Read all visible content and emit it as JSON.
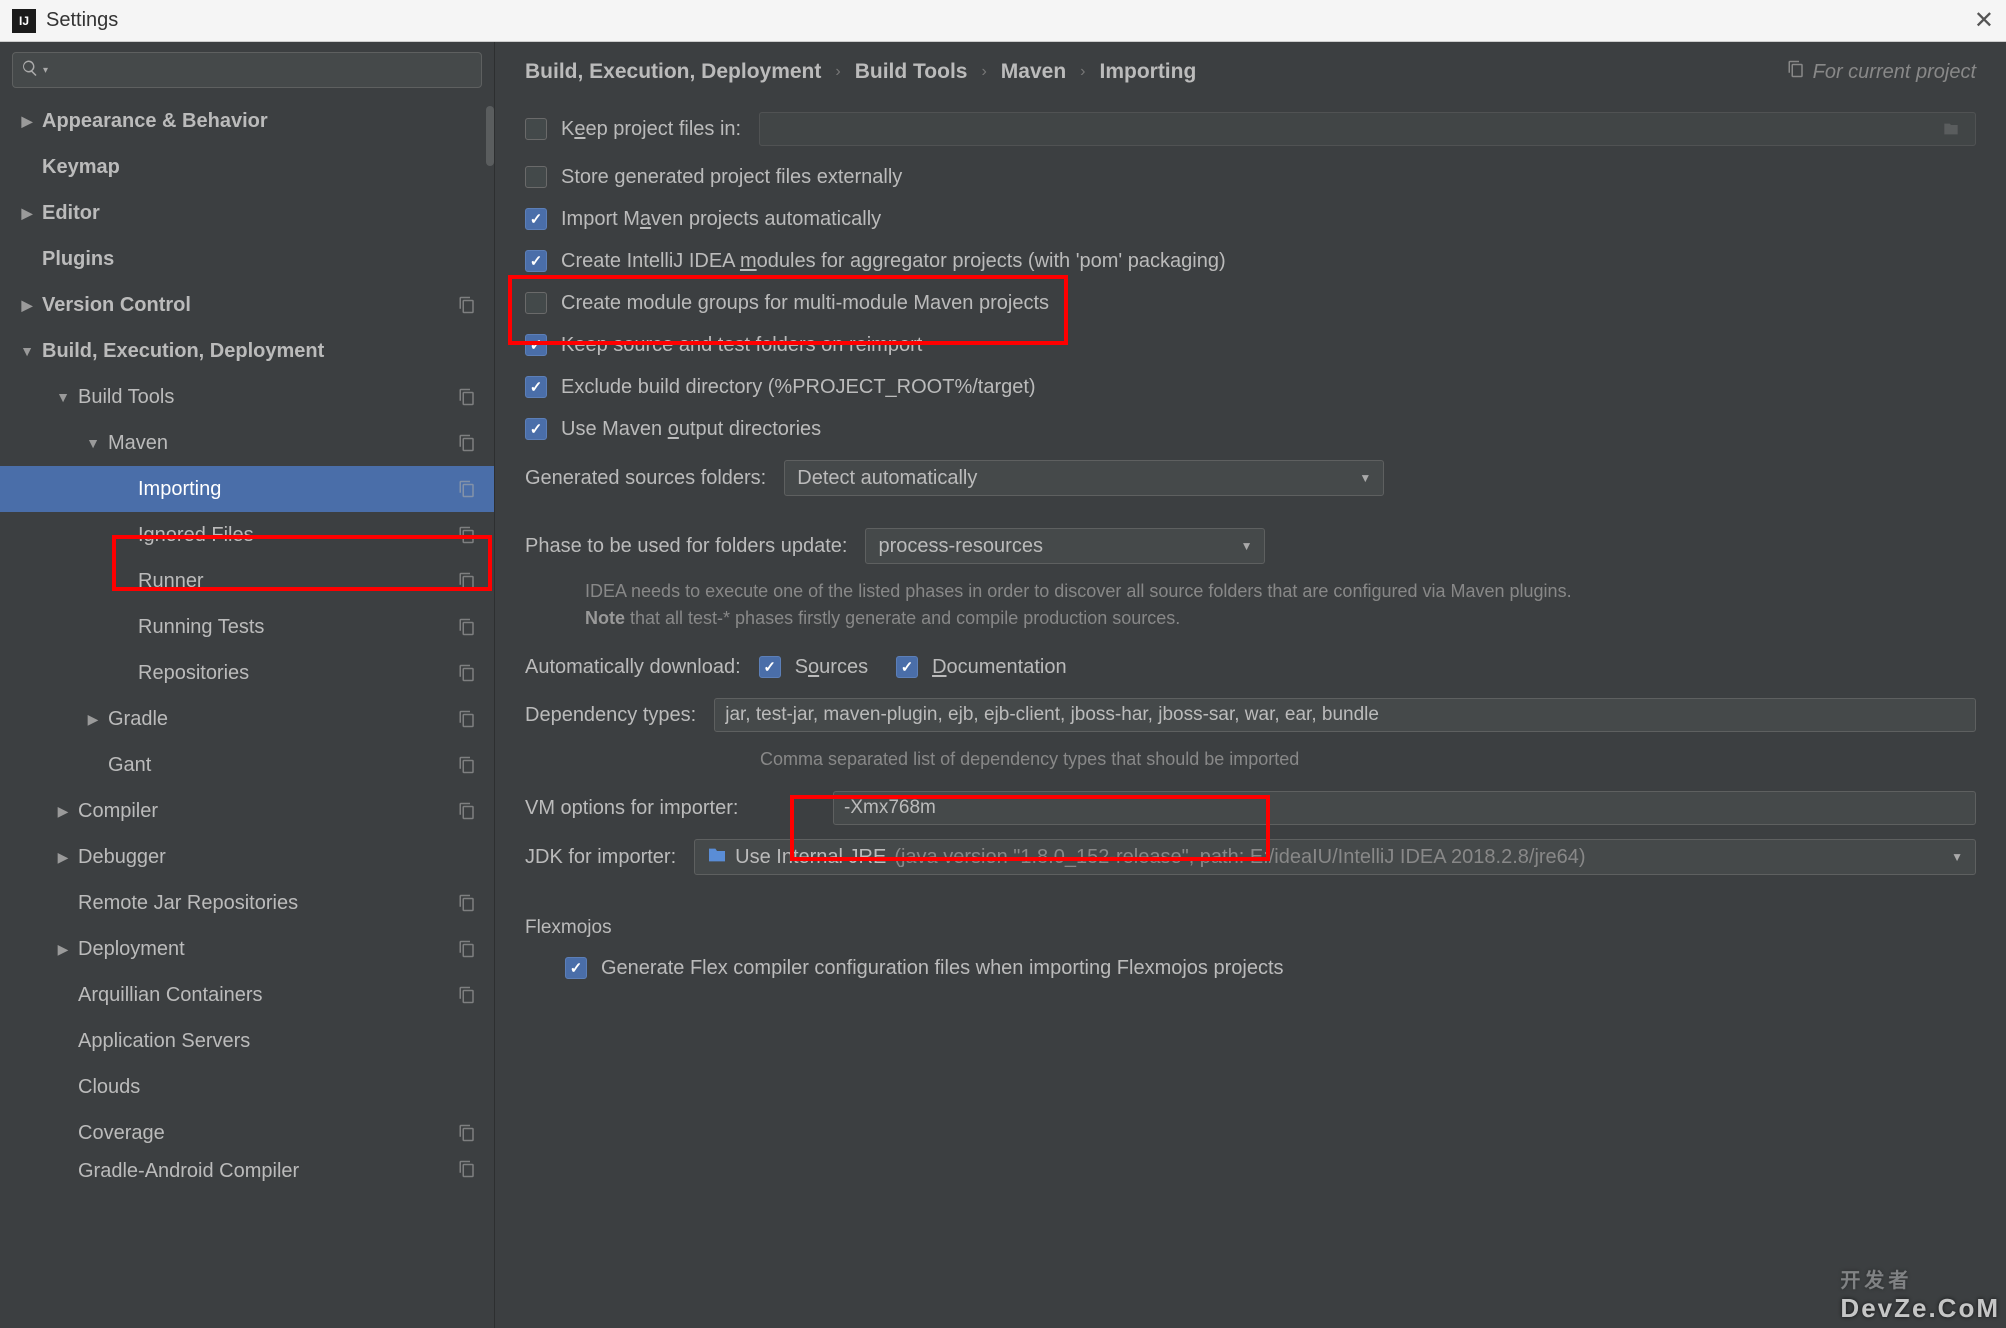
{
  "window": {
    "title": "Settings"
  },
  "breadcrumb": {
    "items": [
      "Build, Execution, Deployment",
      "Build Tools",
      "Maven",
      "Importing"
    ],
    "scope": "For current project"
  },
  "tree": [
    {
      "label": "Appearance & Behavior",
      "bold": true,
      "arrow": "right",
      "indent": 0
    },
    {
      "label": "Keymap",
      "bold": true,
      "arrow": "",
      "indent": 0
    },
    {
      "label": "Editor",
      "bold": true,
      "arrow": "right",
      "indent": 0
    },
    {
      "label": "Plugins",
      "bold": true,
      "arrow": "",
      "indent": 0
    },
    {
      "label": "Version Control",
      "bold": true,
      "arrow": "right",
      "indent": 0,
      "copy": true
    },
    {
      "label": "Build, Execution, Deployment",
      "bold": true,
      "arrow": "down",
      "indent": 0
    },
    {
      "label": "Build Tools",
      "bold": false,
      "arrow": "down",
      "indent": 1,
      "copy": true
    },
    {
      "label": "Maven",
      "bold": false,
      "arrow": "down",
      "indent": 2,
      "copy": true
    },
    {
      "label": "Importing",
      "bold": false,
      "arrow": "",
      "indent": 3,
      "copy": true,
      "selected": true
    },
    {
      "label": "Ignored Files",
      "bold": false,
      "arrow": "",
      "indent": 3,
      "copy": true
    },
    {
      "label": "Runner",
      "bold": false,
      "arrow": "",
      "indent": 3,
      "copy": true
    },
    {
      "label": "Running Tests",
      "bold": false,
      "arrow": "",
      "indent": 3,
      "copy": true
    },
    {
      "label": "Repositories",
      "bold": false,
      "arrow": "",
      "indent": 3,
      "copy": true
    },
    {
      "label": "Gradle",
      "bold": false,
      "arrow": "right",
      "indent": 2,
      "copy": true
    },
    {
      "label": "Gant",
      "bold": false,
      "arrow": "",
      "indent": 2,
      "copy": true
    },
    {
      "label": "Compiler",
      "bold": false,
      "arrow": "right",
      "indent": 1,
      "copy": true
    },
    {
      "label": "Debugger",
      "bold": false,
      "arrow": "right",
      "indent": 1
    },
    {
      "label": "Remote Jar Repositories",
      "bold": false,
      "arrow": "",
      "indent": 1,
      "copy": true
    },
    {
      "label": "Deployment",
      "bold": false,
      "arrow": "right",
      "indent": 1,
      "copy": true
    },
    {
      "label": "Arquillian Containers",
      "bold": false,
      "arrow": "",
      "indent": 1,
      "copy": true
    },
    {
      "label": "Application Servers",
      "bold": false,
      "arrow": "",
      "indent": 1
    },
    {
      "label": "Clouds",
      "bold": false,
      "arrow": "",
      "indent": 1
    },
    {
      "label": "Coverage",
      "bold": false,
      "arrow": "",
      "indent": 1,
      "copy": true
    },
    {
      "label": "Gradle-Android Compiler",
      "bold": false,
      "arrow": "",
      "indent": 1,
      "copy": true,
      "cut": true
    }
  ],
  "form": {
    "keepProjectFiles": {
      "label_pre": "K",
      "label_ul": "e",
      "label_post": "ep project files in:",
      "checked": false,
      "value": ""
    },
    "storeExternally": {
      "label": "Store generated project files externally",
      "checked": false
    },
    "importAuto": {
      "label_pre": "Import M",
      "label_ul": "a",
      "label_post": "ven projects automatically",
      "checked": true
    },
    "createModules": {
      "label_pre": "Create IntelliJ IDEA ",
      "label_ul": "m",
      "label_post": "odules for aggregator projects (with 'pom' packaging)",
      "checked": true
    },
    "createGroups": {
      "label": "Create module groups for multi-module Maven projects",
      "checked": false
    },
    "keepSource": {
      "label": "Keep source and test folders on reimport",
      "checked": true
    },
    "excludeBuild": {
      "label": "Exclude build directory (%PROJECT_ROOT%/target)",
      "checked": true
    },
    "useOutput": {
      "label_pre": "Use Maven ",
      "label_ul": "o",
      "label_post": "utput directories",
      "checked": true
    },
    "generatedSources": {
      "label": "Generated sources folders:",
      "value": "Detect automatically"
    },
    "phase": {
      "label_pre": "Phase to be ",
      "label_ul": "u",
      "label_post": "sed for folders update:",
      "value": "process-resources"
    },
    "phaseHint1": "IDEA needs to execute one of the listed phases in order to discover all source folders that are configured via Maven plugins.",
    "phaseHint2a": "Note",
    "phaseHint2b": " that all test-* phases firstly generate and compile production sources.",
    "autoDownload": {
      "label_pre": "Automatically downl",
      "label_ul": "o",
      "label_post": "ad:"
    },
    "sources": {
      "label_pre": "S",
      "label_ul": "o",
      "label_post": "urces",
      "checked": true
    },
    "documentation": {
      "label_pre": "",
      "label_ul": "D",
      "label_post": "ocumentation",
      "checked": true
    },
    "depTypes": {
      "label": "Dependency types:",
      "value": "jar, test-jar, maven-plugin, ejb, ejb-client, jboss-har, jboss-sar, war, ear, bundle"
    },
    "depHint": "Comma separated list of dependency types that should be imported",
    "vmOptions": {
      "label": "VM options for importer:",
      "value": "-Xmx768m"
    },
    "jdk": {
      "label": "JDK for importer:",
      "value_pre": "Use Internal JRE ",
      "value_grey": "(java version \"1.8.0_152-release\", path: E:/ideaIU/IntelliJ IDEA 2018.2.8/jre64)"
    },
    "flexmojos": {
      "title": "Flexmojos",
      "label": "Generate Flex compiler configuration files when importing Flexmojos projects",
      "checked": true
    }
  },
  "watermark": {
    "top": "开发者",
    "bottom": "DevZe.CoM"
  }
}
